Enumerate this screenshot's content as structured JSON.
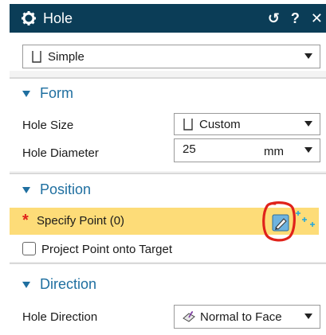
{
  "titlebar": {
    "title": "Hole",
    "reset_glyph": "↺",
    "help_glyph": "?",
    "close_glyph": "✕"
  },
  "type_combo": {
    "value": "Simple"
  },
  "form": {
    "header": "Form",
    "hole_size_label": "Hole Size",
    "hole_size_value": "Custom",
    "hole_diameter_label": "Hole Diameter",
    "hole_diameter_value": "25",
    "hole_diameter_unit": "mm"
  },
  "position": {
    "header": "Position",
    "required_marker": "*",
    "specify_point_label": "Specify Point (0)",
    "project_point_label": "Project Point onto Target",
    "project_point_checked": false
  },
  "direction": {
    "header": "Direction",
    "hole_direction_label": "Hole Direction",
    "hole_direction_value": "Normal to Face"
  },
  "colors": {
    "titlebar_bg": "#0b3d57",
    "section_header": "#1f6fa0",
    "highlight_row": "#fddc78",
    "required_star": "#e0221a",
    "annotation_circle": "#e0221a"
  },
  "icons": {
    "gear": "gear-icon",
    "sketch_point": "sketch-point-icon",
    "point_dialog": "point-constructor-icon",
    "normal_to_face": "normal-to-face-icon",
    "hole_shape": "hole-shape-icon"
  }
}
